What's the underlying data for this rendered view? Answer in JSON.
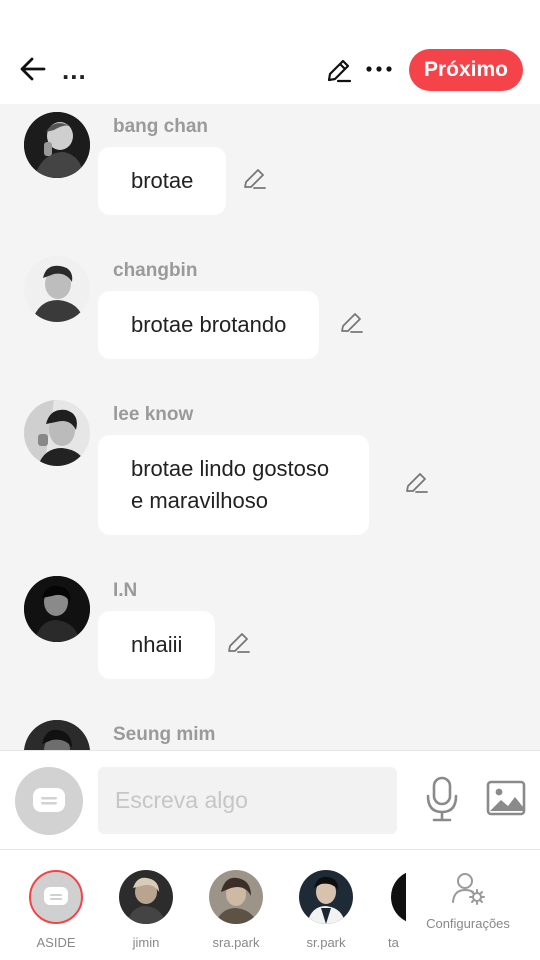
{
  "header": {
    "title": "...",
    "next_label": "Próximo"
  },
  "messages": [
    {
      "sender": "bang chan",
      "lines": [
        "brotae"
      ]
    },
    {
      "sender": "changbin",
      "lines": [
        "brotae brotando"
      ]
    },
    {
      "sender": "lee know",
      "lines": [
        "brotae lindo gostoso",
        "e maravilhoso"
      ]
    },
    {
      "sender": "I.N",
      "lines": [
        "nhaiii"
      ]
    },
    {
      "sender": "Seung mim",
      "lines": []
    }
  ],
  "composer": {
    "placeholder": "Escreva algo"
  },
  "channels": [
    {
      "label": "ASIDE"
    },
    {
      "label": "jimin"
    },
    {
      "label": "sra.park"
    },
    {
      "label": "sr.park"
    },
    {
      "label": "ta"
    }
  ],
  "settings": {
    "label": "Configurações"
  },
  "colors": {
    "accent": "#f5434a",
    "bubble": "#ffffff",
    "background": "#f4f4f4"
  }
}
